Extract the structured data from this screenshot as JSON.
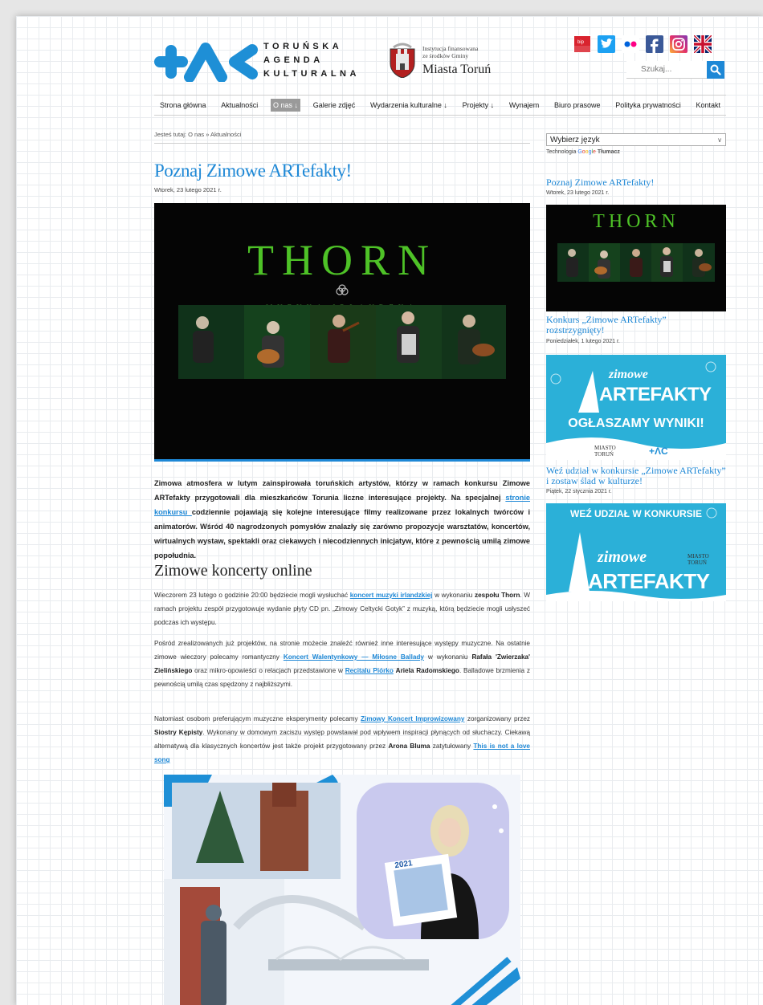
{
  "header": {
    "logo_lines": [
      "TORUŃSKA",
      "AGENDA",
      "KULTURALNA"
    ],
    "funding_small_line1": "Instytucja finansowana",
    "funding_small_line2": "ze środków Gminy",
    "funding_city": "Miasta Toruń",
    "social_icons": [
      "bip-icon",
      "twitter-icon",
      "flickr-icon",
      "facebook-icon",
      "instagram-icon",
      "uk-flag-icon"
    ],
    "search_placeholder": "Szukaj..."
  },
  "nav": {
    "items": [
      "Strona główna",
      "Aktualności",
      "O nas ↓",
      "Galerie zdjęć",
      "Wydarzenia kulturalne ↓",
      "Projekty ↓",
      "Wynajem",
      "Biuro prasowe",
      "Polityka prywatności",
      "Kontakt"
    ],
    "active_index": 2
  },
  "breadcrumb": "Jesteś tutaj: O nas » Aktualności",
  "article": {
    "title": "Poznaj Zimowe ARTefakty!",
    "date": "Wtorek, 23 lutego 2021 r.",
    "hero_title": "THORN",
    "hero_subtitle": "MUZYKA IRLANDZKA",
    "intro_1": "Zimowa atmosfera w lutym zainspirowała toruńskich artystów, którzy w ramach konkursu Zimowe ARTefakty przygotowali dla mieszkańców Torunia liczne interesujące projekty. Na specjalnej ",
    "intro_link": "stronie konkursu ",
    "intro_2": "codziennie pojawiają się kolejne interesujące filmy realizowane przez lokalnych twórców i animatorów. Wśród 40 nagrodzonych pomysłów znalazły się zarówno propozycje warsztatów, koncertów, wirtualnych wystaw, spektakli oraz ciekawych i niecodziennych inicjatyw, które z pewnością umilą zimowe popołudnia.",
    "section_heading": "Zimowe koncerty online",
    "p1": {
      "t1": "Wieczorem 23 lutego o godzinie 20:00 będziecie mogli wysłuchać ",
      "link1": "koncert muzyki irlandzkiej",
      "t2": " w wykonaniu ",
      "b1": "zespołu Thorn",
      "t3": ". W ramach projektu zespół przygotowuje wydanie płyty CD pn. „Zimowy Celtycki Gotyk” z muzyką, którą będziecie mogli usłyszeć podczas ich występu."
    },
    "p2": {
      "t1": "Pośród zrealizowanych już projektów, na stronie możecie znaleźć również inne interesujące występy muzyczne. Na ostatnie zimowe wieczory polecamy romantyczny ",
      "link1": "Koncert Walentynkowy — Miłosne Ballady",
      "t2": " w wykonaniu ",
      "b1": "Rafała 'Zwierzaka' Zielińskiego",
      "t3": " oraz mikro-opowieści o relacjach przedstawione w ",
      "link2": "Recitalu Piórko",
      "t4": " ",
      "b2": "Ariela Radomskiego",
      "t5": ". Balladowe brzmienia z pewnością umilą czas spędzony z najbliższymi."
    },
    "p3": {
      "t1": "Natomiast osobom preferującym muzyczne eksperymenty polecamy ",
      "link1": "Zimowy Koncert Improwizowany",
      "t2": " zorganizowany przez ",
      "b1": "Siostry Kępisty",
      "t3": ". Wykonany w domowym zaciszu występ powstawał pod wpływem inspiracji płynących od słuchaczy. Ciekawą alternatywą dla klasycznych koncertów jest także projekt przygotowany przez ",
      "b2": "Arona Bluma",
      "t4": " zatytułowany ",
      "link2": "This is not a love song"
    },
    "collage_badge": "2021"
  },
  "sidebar": {
    "language_select": "Wybierz język",
    "translate_prefix": "Technologia ",
    "translate_google": [
      "G",
      "o",
      "o",
      "g",
      "l",
      "e"
    ],
    "translate_suffix": "Tłumacz",
    "posts": [
      {
        "title": "Poznaj Zimowe ARTefakty!",
        "date": "Wtorek, 23 lutego 2021 r.",
        "image_text": "THORN"
      },
      {
        "title": "Konkurs „Zimowe ARTefakty” rozstrzygnięty!",
        "date": "Poniedziałek, 1 lutego 2021 r.",
        "image_text_1": "zimowe",
        "image_text_2": "ARTEFAKTY",
        "image_text_3": "OGŁASZAMY WYNIKI!",
        "image_logo_text": "MIASTO TORUŃ"
      },
      {
        "title": "Weź udział w konkursie „Zimowe ARTefakty” i zostaw ślad w kulturze!",
        "date": "Piątek, 22 stycznia 2021 r.",
        "image_text_1": "WEŹ UDZIAŁ W KONKURSIE",
        "image_text_2": "zimowe",
        "image_text_3": "ARTEFAKTY",
        "image_logo_text": "MIASTO TORUŃ"
      }
    ]
  },
  "colors": {
    "accent": "#1e88d6",
    "brand_blue": "#1e8fd6",
    "banner_teal": "#2bb0d8",
    "thorn_green": "#4ec227"
  }
}
